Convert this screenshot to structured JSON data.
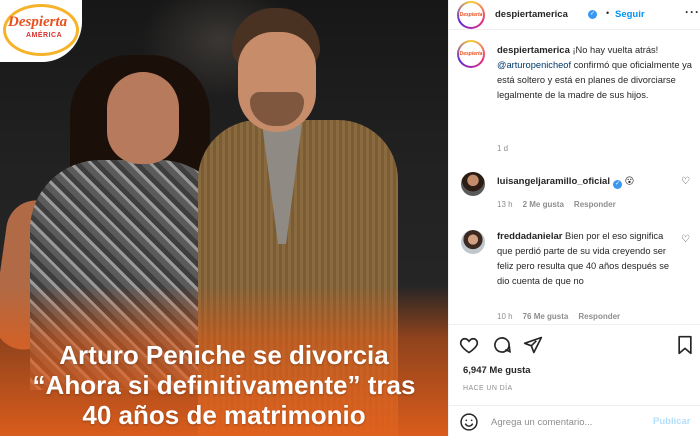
{
  "post": {
    "headline": [
      "Arturo Peniche se divorcia",
      "“Ahora si definitivamente” tras",
      "40 años de matrimonio"
    ],
    "logo": {
      "brand": "Despierta",
      "sub": "AMÉRICA"
    },
    "accent_orange": "#e8601a"
  },
  "header": {
    "username": "despiertamerica",
    "separator": "•",
    "follow_label": "Seguir",
    "more_icon": "more-options-icon"
  },
  "caption": {
    "username": "despiertamerica",
    "text_before": " ¡No hay vuelta atrás! ",
    "mention": "@arturopenicheof",
    "text_after": " confirmó que oficialmente ya está soltero y está en planes de divorciarse legalmente de la madre de sus hijos.",
    "age": "1 d"
  },
  "comments": [
    {
      "username": "luisangeljaramillo_oficial",
      "text": " 😮",
      "age": "13 h",
      "likes": "2 Me gusta",
      "reply": "Responder"
    },
    {
      "username": "freddadanielar",
      "text": " Bien por el eso significa que perdió parte de su vida creyendo ser feliz pero resulta que 40 años después se dio cuenta de que no",
      "age": "10 h",
      "likes": "76 Me gusta",
      "reply": "Responder"
    }
  ],
  "actions": {
    "likes": "6,947 Me gusta",
    "time": "HACE UN DÍA",
    "comment_placeholder": "Agrega un comentario...",
    "publish_label": "Publicar"
  },
  "colors": {
    "link": "#0095f6",
    "mention": "#00376b",
    "muted": "#8e8e8e",
    "verified": "#3897f0"
  }
}
